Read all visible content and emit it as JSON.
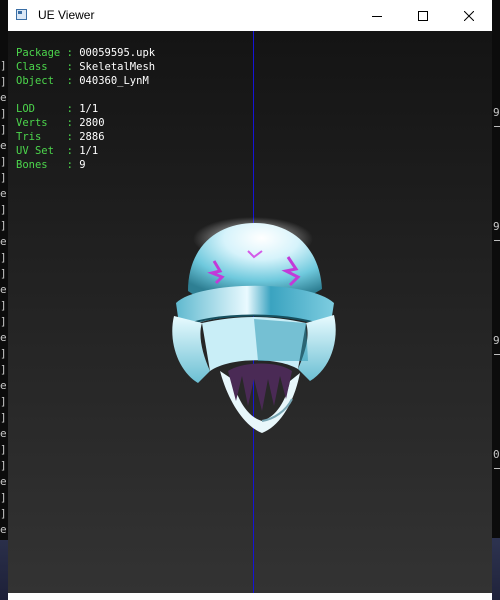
{
  "window": {
    "title": "UE Viewer"
  },
  "info_panel": {
    "rows_top": [
      {
        "key": "Package",
        "sep": " : ",
        "value": "00059595.upk"
      },
      {
        "key": "Class  ",
        "sep": " : ",
        "value": "SkeletalMesh"
      },
      {
        "key": "Object ",
        "sep": " : ",
        "value": "040360_LynM"
      }
    ],
    "rows_bottom": [
      {
        "key": "LOD    ",
        "sep": " : ",
        "value": "1/1"
      },
      {
        "key": "Verts  ",
        "sep": " : ",
        "value": "2800"
      },
      {
        "key": "Tris   ",
        "sep": " : ",
        "value": "2886"
      },
      {
        "key": "UV Set ",
        "sep": " : ",
        "value": "1/1"
      },
      {
        "key": "Bones  ",
        "sep": " : ",
        "value": "9"
      }
    ]
  },
  "background_console": {
    "left_glyphs": [
      "]",
      "]",
      "e",
      "]",
      "]",
      "e",
      "]",
      "]",
      "e",
      "]",
      "]",
      "e",
      "]",
      "]",
      "e",
      "]",
      "]",
      "e",
      "]",
      "]",
      "e",
      "]",
      "]",
      "e",
      "]",
      "]",
      "e",
      "]",
      "]",
      "e",
      "]"
    ],
    "right_glyphs": [
      "9",
      "9",
      "9",
      "0"
    ]
  },
  "colors": {
    "axis": "#1414d8",
    "label": "#4cd64c",
    "value": "#ffffff"
  }
}
